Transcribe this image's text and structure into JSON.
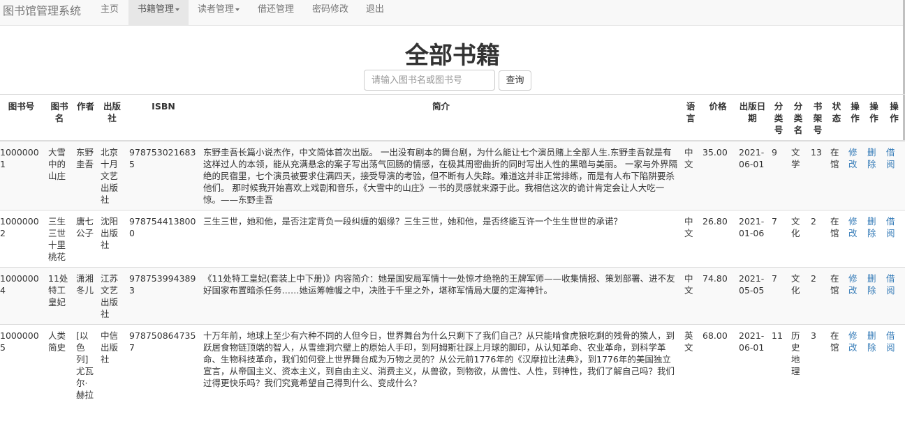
{
  "navbar": {
    "brand": "图书馆管理系统",
    "items": [
      {
        "label": "主页"
      },
      {
        "label": "书籍管理"
      },
      {
        "label": "读者管理"
      },
      {
        "label": "借还管理"
      },
      {
        "label": "密码修改"
      },
      {
        "label": "退出"
      }
    ]
  },
  "page": {
    "title": "全部书籍",
    "search_placeholder": "请输入图书名或图书号",
    "search_button": "查询"
  },
  "table": {
    "headers": [
      "图书号",
      "图书名",
      "作者",
      "出版社",
      "ISBN",
      "简介",
      "语言",
      "价格",
      "出版日期",
      "分类号",
      "分类名",
      "书架号",
      "状态",
      "操作",
      "操作",
      "操作"
    ],
    "rows": [
      {
        "id": "10000001",
        "name": "大雪中的山庄",
        "author": "东野圭吾",
        "publisher": "北京十月文艺出版社",
        "isbn": "9787530216835",
        "intro": "东野圭吾长篇小说杰作，中文简体首次出版。 一出没有剧本的舞台剧，为什么能让七个演员赌上全部人生.东野圭吾就是有这样过人的本领，能从充满悬念的案子写出荡气回肠的情感，在极其周密曲折的同时写出人性的黑暗与美丽。 一家与外界隔绝的民宿里，七个演员被要求住满四天，接受导演的考验，但不断有人失踪。难道这并非正常排练，而是有人布下陷阱要杀他们。 那时候我开始喜欢上戏剧和音乐，《大雪中的山庄》一书的灵感就来源于此。我相信这次的诡计肯定会让人大吃一惊。——东野圭吾",
        "language": "中文",
        "price": "35.00",
        "date": "2021-06-01",
        "class_id": "9",
        "class_name": "文学",
        "shelf": "13",
        "status": "在馆",
        "op_edit": "修改",
        "op_delete": "删除",
        "op_borrow": "借阅"
      },
      {
        "id": "10000002",
        "name": "三生三世十里桃花",
        "author": "唐七公子",
        "publisher": "沈阳出版社",
        "isbn": "9787544138000",
        "intro": "三生三世，她和他，是否注定背负一段纠缠的姻缘？三生三世，她和他，是否终能互许一个生生世世的承诺？",
        "language": "中文",
        "price": "26.80",
        "date": "2021-01-06",
        "class_id": "7",
        "class_name": "文化",
        "shelf": "2",
        "status": "在馆",
        "op_edit": "修改",
        "op_delete": "删除",
        "op_borrow": "借阅"
      },
      {
        "id": "10000004",
        "name": "11处特工皇妃",
        "author": "潇湘冬儿",
        "publisher": "江苏文艺出版社",
        "isbn": "9787539943893",
        "intro": "《11处特工皇妃(套装上中下册)》内容简介：她是国安局军情十一处惊才绝艳的王牌军师——收集情报、策划部署、进不友好国家布置暗杀任务……她运筹帷幄之中，决胜于千里之外，堪称军情局大厦的定海神针。",
        "language": "中文",
        "price": "74.80",
        "date": "2021-05-05",
        "class_id": "7",
        "class_name": "文化",
        "shelf": "2",
        "status": "在馆",
        "op_edit": "修改",
        "op_delete": "删除",
        "op_borrow": "借阅"
      },
      {
        "id": "10000005",
        "name": "人类简史",
        "author": "[以色列]尤瓦尔·赫拉",
        "publisher": "中信出版社",
        "isbn": "9787508647357",
        "intro": "十万年前，地球上至少有六种不同的人但今日，世界舞台为什么只剩下了我们自己？从只能啃食虎狼吃剩的残骨的猿人，到跃居食物链顶端的智人，从雪维洞穴壁上的原始人手印，到阿姆斯壮踩上月球的脚印，从认知革命、农业革命，到科学革命、生物科技革命，我们如何登上世界舞台成为万物之灵的？从公元前1776年的《汉摩拉比法典》，到1776年的美国独立宣言，从帝国主义、资本主义，到自由主义、消费主义，从兽欲，到物欲，从兽性、人性，到神性，我们了解自己吗？我们过得更快乐吗？我们究竟希望自己得到什么、变成什么？",
        "language": "英文",
        "price": "68.00",
        "date": "2021-06-01",
        "class_id": "11",
        "class_name": "历史地理",
        "shelf": "3",
        "status": "在馆",
        "op_edit": "修改",
        "op_delete": "删除",
        "op_borrow": "借阅"
      }
    ]
  }
}
